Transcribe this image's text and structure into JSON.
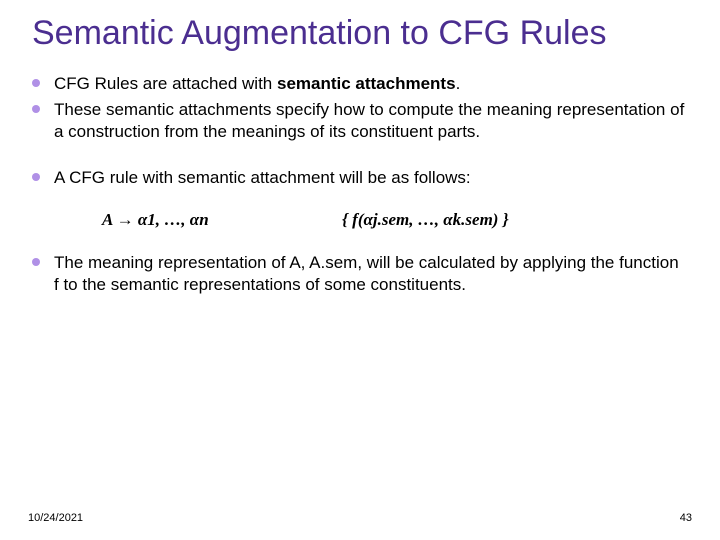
{
  "slide": {
    "title": "Semantic Augmentation to CFG Rules",
    "bullets": {
      "b1_pre": "CFG Rules are attached with ",
      "b1_bold": "semantic attachments",
      "b1_post": ".",
      "b2": "These semantic attachments specify how to compute the meaning representation of a construction from the meanings of its constituent parts.",
      "b3": "A CFG rule with semantic attachment will be as follows:",
      "b4": "The meaning representation of A, A.sem, will be calculated by applying the function f to the semantic representations of some constituents."
    },
    "formula": {
      "lhs": "A → α1, …, αn",
      "rhs": "{ f(αj.sem, …, αk.sem) }"
    },
    "footer": {
      "date": "10/24/2021",
      "page": "43"
    }
  }
}
